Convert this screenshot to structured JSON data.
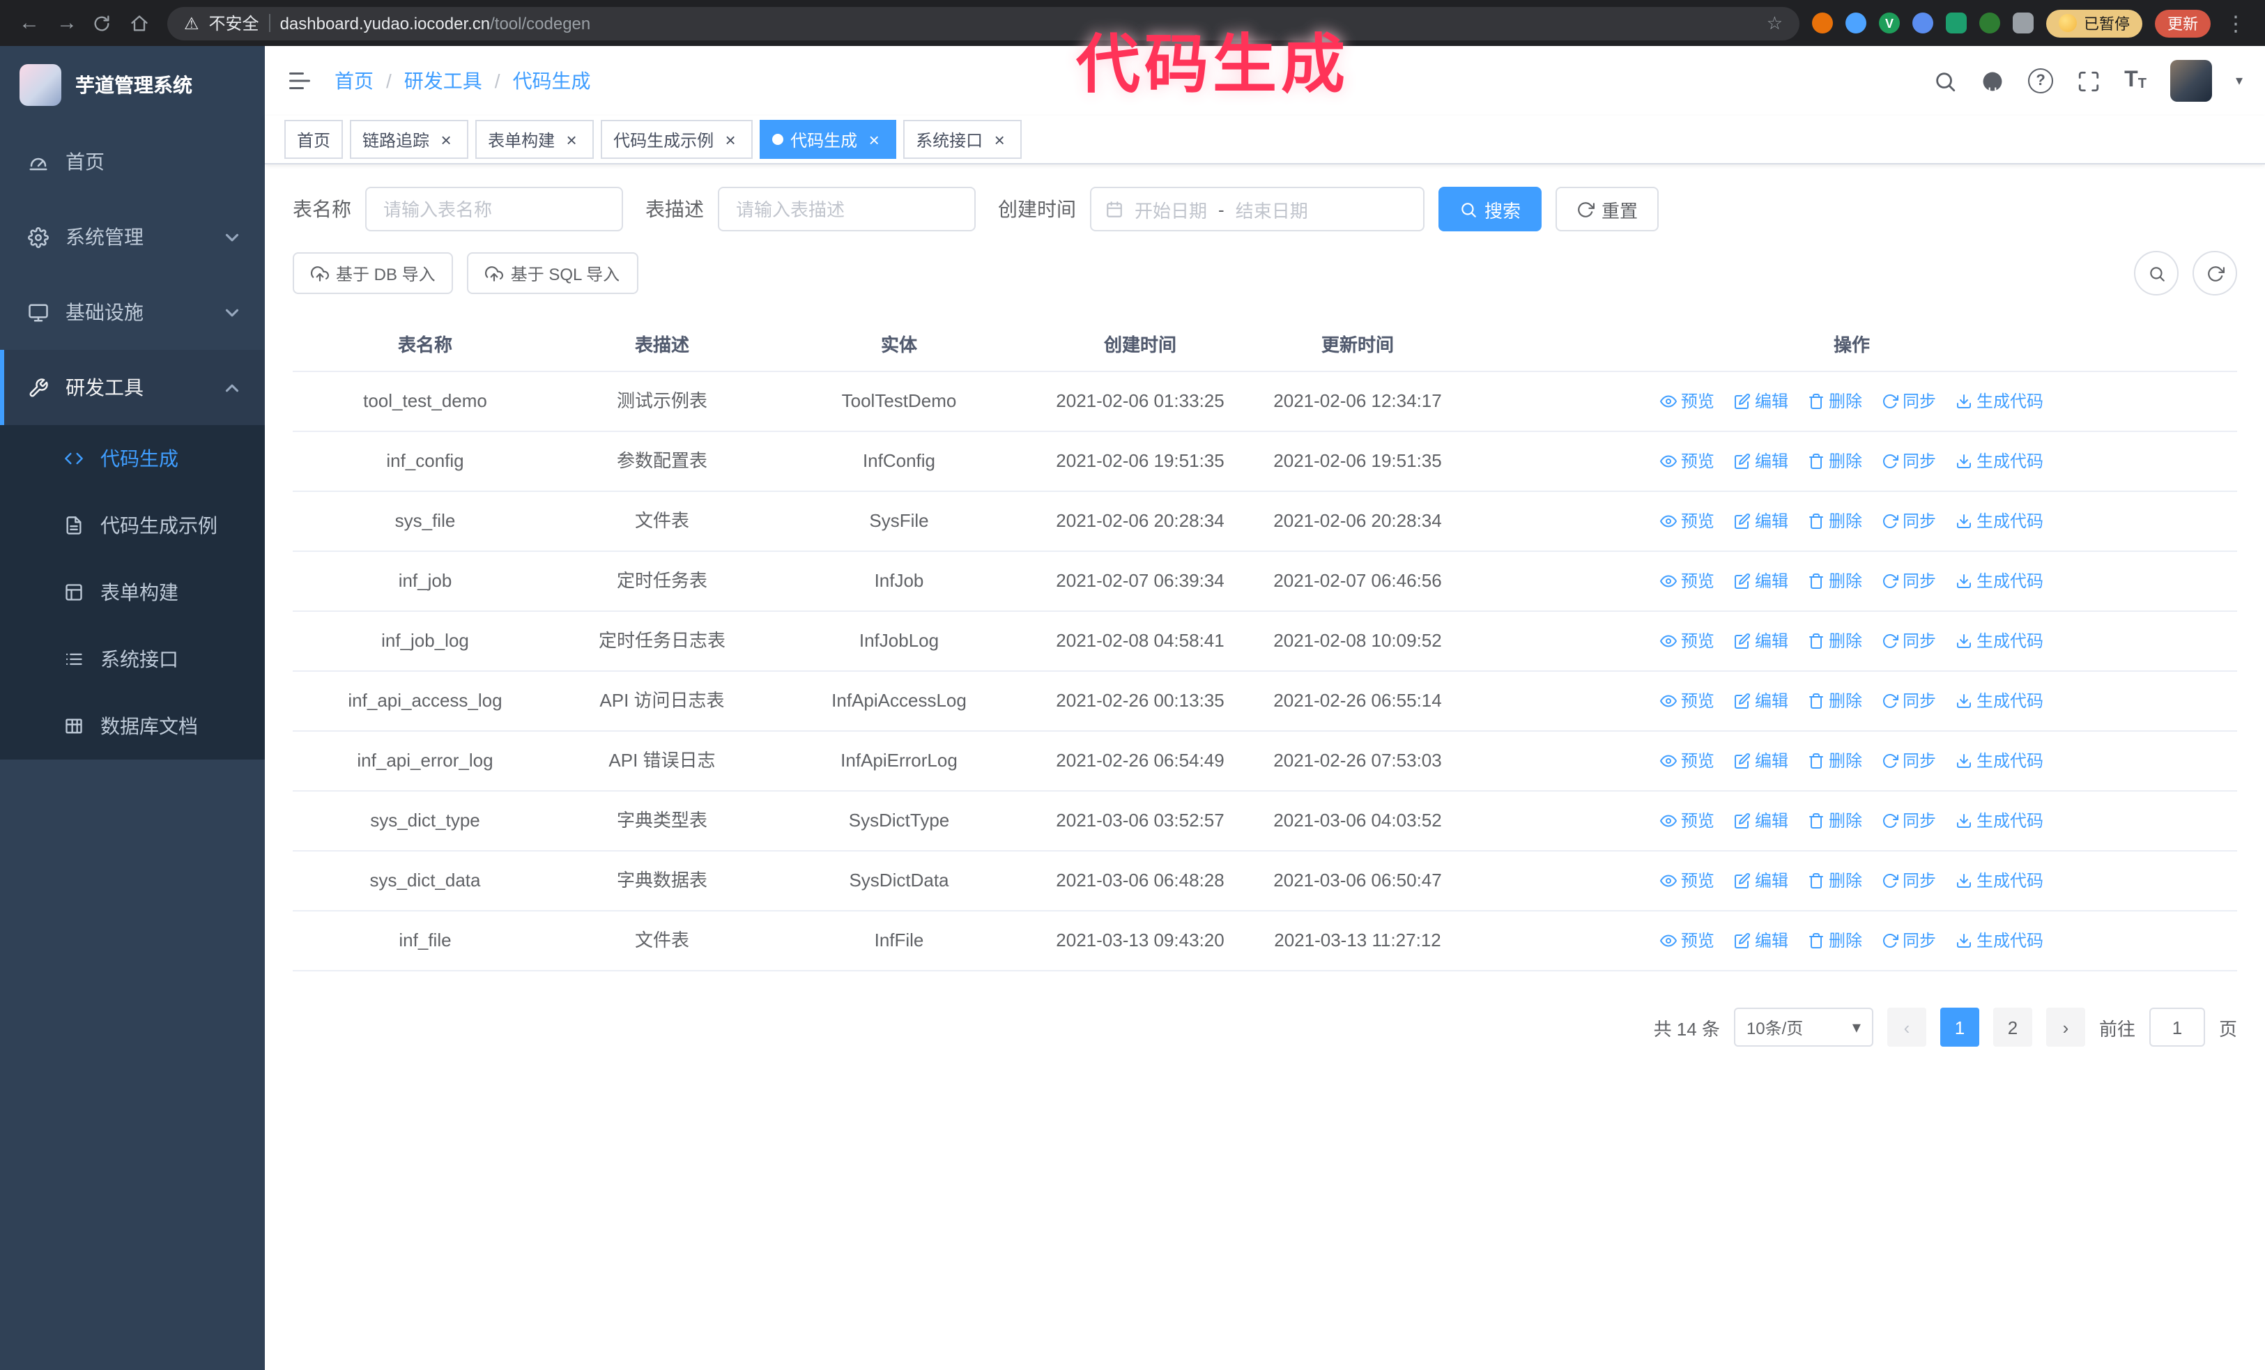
{
  "overlay": {
    "title": "代码生成"
  },
  "icons": {
    "back": "←",
    "forward": "→",
    "star": "☆",
    "warning": "⚠",
    "kebab": "⋮",
    "caret": "▾",
    "prev": "‹",
    "next": "›",
    "close": "×",
    "sep": "/",
    "question": "?",
    "font_big": "T",
    "font_small": "T"
  },
  "browser": {
    "security_label": "不安全",
    "url_domain": "dashboard.yudao.iocoder.cn",
    "url_path": "/tool/codegen",
    "paused_badge": "已暂停",
    "update_button": "更新"
  },
  "sidebar": {
    "logo_title": "芋道管理系统",
    "items": [
      {
        "label": "首页"
      },
      {
        "label": "系统管理"
      },
      {
        "label": "基础设施"
      },
      {
        "label": "研发工具"
      }
    ],
    "sub_items": [
      {
        "label": "代码生成"
      },
      {
        "label": "代码生成示例"
      },
      {
        "label": "表单构建"
      },
      {
        "label": "系统接口"
      },
      {
        "label": "数据库文档"
      }
    ]
  },
  "breadcrumb": {
    "items": [
      "首页",
      "研发工具",
      "代码生成"
    ]
  },
  "tabs": [
    {
      "label": "首页",
      "closable": false,
      "active": false
    },
    {
      "label": "链路追踪",
      "closable": true,
      "active": false
    },
    {
      "label": "表单构建",
      "closable": true,
      "active": false
    },
    {
      "label": "代码生成示例",
      "closable": true,
      "active": false
    },
    {
      "label": "代码生成",
      "closable": true,
      "active": true
    },
    {
      "label": "系统接口",
      "closable": true,
      "active": false
    }
  ],
  "filters": {
    "table_name_label": "表名称",
    "table_name_placeholder": "请输入表名称",
    "table_desc_label": "表描述",
    "table_desc_placeholder": "请输入表描述",
    "create_time_label": "创建时间",
    "date_start_placeholder": "开始日期",
    "date_separator": "-",
    "date_end_placeholder": "结束日期",
    "search_button": "搜索",
    "reset_button": "重置"
  },
  "toolbar": {
    "import_db": "基于 DB 导入",
    "import_sql": "基于 SQL 导入"
  },
  "table": {
    "columns": [
      "表名称",
      "表描述",
      "实体",
      "创建时间",
      "更新时间",
      "操作"
    ],
    "actions": [
      "预览",
      "编辑",
      "删除",
      "同步",
      "生成代码"
    ],
    "rows": [
      {
        "name": "tool_test_demo",
        "desc": "测试示例表",
        "entity": "ToolTestDemo",
        "create_time": "2021-02-06 01:33:25",
        "update_time": "2021-02-06 12:34:17"
      },
      {
        "name": "inf_config",
        "desc": "参数配置表",
        "entity": "InfConfig",
        "create_time": "2021-02-06 19:51:35",
        "update_time": "2021-02-06 19:51:35"
      },
      {
        "name": "sys_file",
        "desc": "文件表",
        "entity": "SysFile",
        "create_time": "2021-02-06 20:28:34",
        "update_time": "2021-02-06 20:28:34"
      },
      {
        "name": "inf_job",
        "desc": "定时任务表",
        "entity": "InfJob",
        "create_time": "2021-02-07 06:39:34",
        "update_time": "2021-02-07 06:46:56"
      },
      {
        "name": "inf_job_log",
        "desc": "定时任务日志表",
        "entity": "InfJobLog",
        "create_time": "2021-02-08 04:58:41",
        "update_time": "2021-02-08 10:09:52"
      },
      {
        "name": "inf_api_access_log",
        "desc": "API 访问日志表",
        "entity": "InfApiAccessLog",
        "create_time": "2021-02-26 00:13:35",
        "update_time": "2021-02-26 06:55:14"
      },
      {
        "name": "inf_api_error_log",
        "desc": "API 错误日志",
        "entity": "InfApiErrorLog",
        "create_time": "2021-02-26 06:54:49",
        "update_time": "2021-02-26 07:53:03"
      },
      {
        "name": "sys_dict_type",
        "desc": "字典类型表",
        "entity": "SysDictType",
        "create_time": "2021-03-06 03:52:57",
        "update_time": "2021-03-06 04:03:52"
      },
      {
        "name": "sys_dict_data",
        "desc": "字典数据表",
        "entity": "SysDictData",
        "create_time": "2021-03-06 06:48:28",
        "update_time": "2021-03-06 06:50:47"
      },
      {
        "name": "inf_file",
        "desc": "文件表",
        "entity": "InfFile",
        "create_time": "2021-03-13 09:43:20",
        "update_time": "2021-03-13 11:27:12"
      }
    ]
  },
  "pagination": {
    "total": "共 14 条",
    "page_size": "10条/页",
    "pages": [
      "1",
      "2"
    ],
    "goto_label": "前往",
    "goto_value": "1",
    "goto_unit": "页"
  }
}
